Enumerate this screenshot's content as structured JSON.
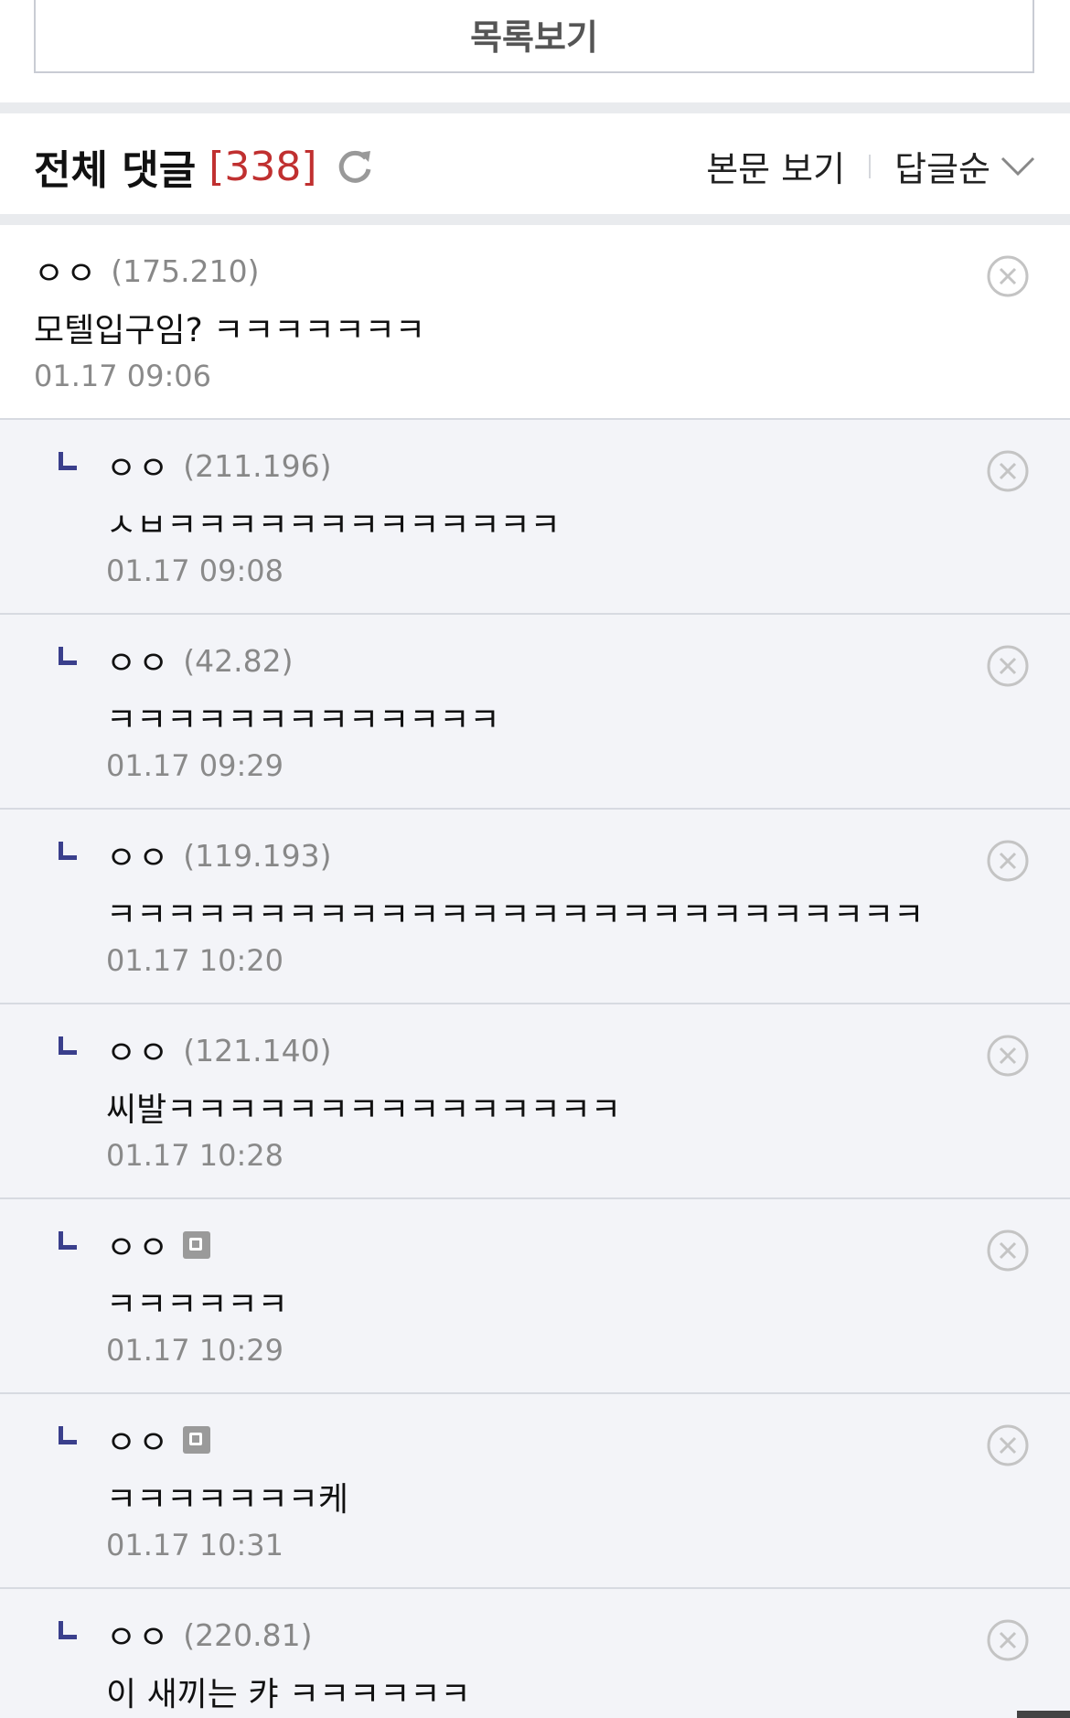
{
  "list_button": {
    "label": "목록보기"
  },
  "header": {
    "title": "전체 댓글",
    "count": "[338]",
    "view_post_label": "본문 보기",
    "sort_label": "답글순"
  },
  "comments": [
    {
      "nick": "ㅇㅇ",
      "ip": "(175.210)",
      "text": "모텔입구임? ㅋㅋㅋㅋㅋㅋㅋ",
      "date": "01.17 09:06"
    },
    {
      "nick": "ㅇㅇ",
      "ip": "(211.196)",
      "text": "ㅅㅂㅋㅋㅋㅋㅋㅋㅋㅋㅋㅋㅋㅋㅋ",
      "date": "01.17 09:08"
    },
    {
      "nick": "ㅇㅇ",
      "ip": "(42.82)",
      "text": "ㅋㅋㅋㅋㅋㅋㅋㅋㅋㅋㅋㅋㅋ",
      "date": "01.17 09:29"
    },
    {
      "nick": "ㅇㅇ",
      "ip": "(119.193)",
      "text": "ㅋㅋㅋㅋㅋㅋㅋㅋㅋㅋㅋㅋㅋㅋㅋㅋㅋㅋㅋㅋㅋㅋㅋㅋㅋㅋㅋ",
      "date": "01.17 10:20"
    },
    {
      "nick": "ㅇㅇ",
      "ip": "(121.140)",
      "text": "씨발ㅋㅋㅋㅋㅋㅋㅋㅋㅋㅋㅋㅋㅋㅋㅋ",
      "date": "01.17 10:28"
    },
    {
      "nick": "ㅇㅇ",
      "ip": "",
      "text": "ㅋㅋㅋㅋㅋㅋ",
      "date": "01.17 10:29"
    },
    {
      "nick": "ㅇㅇ",
      "ip": "",
      "text": "ㅋㅋㅋㅋㅋㅋㅋ케",
      "date": "01.17 10:31"
    },
    {
      "nick": "ㅇㅇ",
      "ip": "(220.81)",
      "text": "이 새끼는 캬 ㅋㅋㅋㅋㅋㅋ",
      "date": ""
    }
  ],
  "colors": {
    "accent": "#c03030",
    "reply_mark": "#3a3f8c",
    "reply_bg": "#f3f4f8"
  },
  "icons": [
    "refresh-icon",
    "chevron-down-icon",
    "delete-icon",
    "fixed-nick-icon"
  ]
}
